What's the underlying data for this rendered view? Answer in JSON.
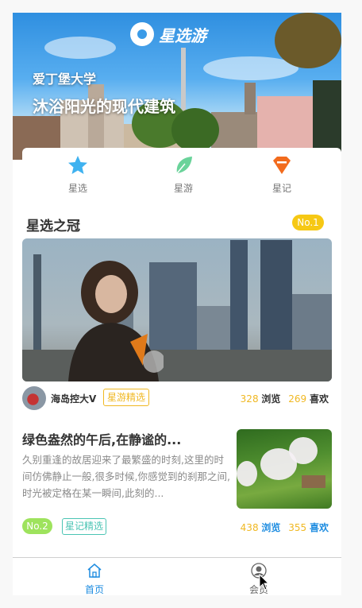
{
  "banner": {
    "logo_text": "星选游",
    "subtitle": "爱丁堡大学",
    "title": "沐浴阳光的现代建筑"
  },
  "nav": {
    "items": [
      {
        "label": "星选",
        "icon": "star-icon",
        "color": "#3fb2f0"
      },
      {
        "label": "星游",
        "icon": "leaf-icon",
        "color": "#6ad39a"
      },
      {
        "label": "星记",
        "icon": "gem-icon",
        "color": "#f26b1d"
      }
    ]
  },
  "featured": {
    "section_title": "星选之冠",
    "rank_badge": "No.1",
    "author": "海岛控大V",
    "tag": "星游精选",
    "views": "328",
    "views_label": "浏览",
    "likes": "269",
    "likes_label": "喜欢"
  },
  "article": {
    "title": "绿色盎然的午后,在静谧的...",
    "description": "久别重逢的故居迎来了最繁盛的时刻,这里的时间仿佛静止一般,很多时候,你感觉到的刹那之间,时光被定格在某一瞬间,此刻的...",
    "rank_badge": "No.2",
    "tag": "星记精选",
    "views": "438",
    "views_label": "浏览",
    "likes": "355",
    "likes_label": "喜欢"
  },
  "tabbar": {
    "items": [
      {
        "label": "首页",
        "icon": "home-icon",
        "active": true
      },
      {
        "label": "会员",
        "icon": "user-icon",
        "active": false
      }
    ]
  },
  "colors": {
    "accent_gold": "#f0b822",
    "accent_blue": "#1d8ce0",
    "accent_green": "#9ee35d",
    "accent_teal": "#4bc4b4"
  }
}
